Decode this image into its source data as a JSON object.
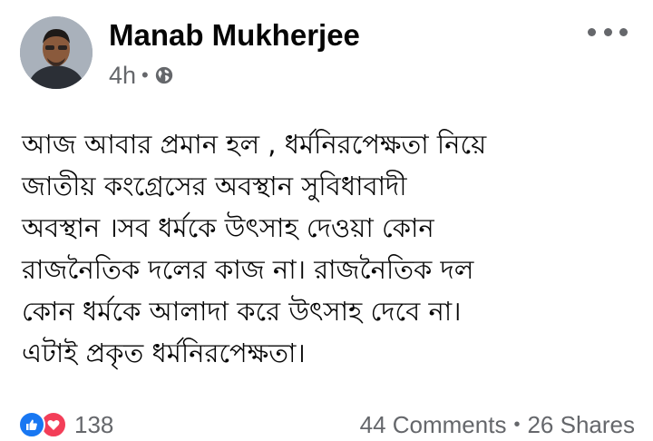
{
  "post": {
    "author_name": "Manab Mukherjee",
    "timestamp": "4h",
    "separator": "•",
    "audience_icon": "globe-icon",
    "more_icon": "more-options-icon",
    "body_lines": [
      "আজ আবার প্রমান হল , ধর্মনিরপেক্ষতা নিয়ে",
      "জাতীয় কংগ্রেসের অবস্থান সুবিধাবাদী",
      "অবস্থান ।সব ধর্মকে উৎসাহ দেওয়া কোন",
      "রাজনৈতিক দলের কাজ না। রাজনৈতিক দল",
      "কোন ধর্মকে আলাদা করে উৎসাহ দেবে না।",
      "এটাই প্রকৃত ধর্মনিরপেক্ষতা।"
    ]
  },
  "footer": {
    "reaction_icons": [
      "like-icon",
      "love-icon"
    ],
    "reaction_count": "138",
    "comments": "44 Comments",
    "separator": "•",
    "shares": "26 Shares"
  },
  "colors": {
    "text_primary": "#050505",
    "text_secondary": "#65676b",
    "like_blue": "#1877f2",
    "love_red": "#f33e58"
  }
}
